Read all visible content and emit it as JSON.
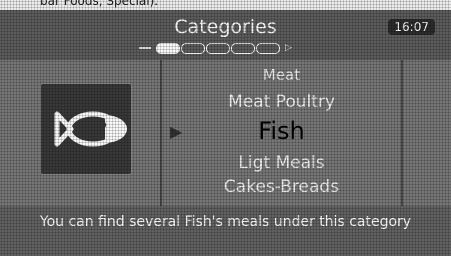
{
  "top_strip": {
    "text": "bar Foods, Special)."
  },
  "header": {
    "title": "Categories",
    "clock": "16:07",
    "pager": {
      "pages": 5,
      "current": 1
    }
  },
  "category_icon": {
    "icon": "fish-icon"
  },
  "menu": {
    "items": [
      {
        "label": "Meat"
      },
      {
        "label": "Meat Poultry"
      },
      {
        "label": "Fish"
      },
      {
        "label": "Ligt Meals"
      },
      {
        "label": "Cakes-Breads"
      }
    ],
    "selected_index": 2
  },
  "footer": {
    "info": "You can find several Fish's meals under this category"
  }
}
